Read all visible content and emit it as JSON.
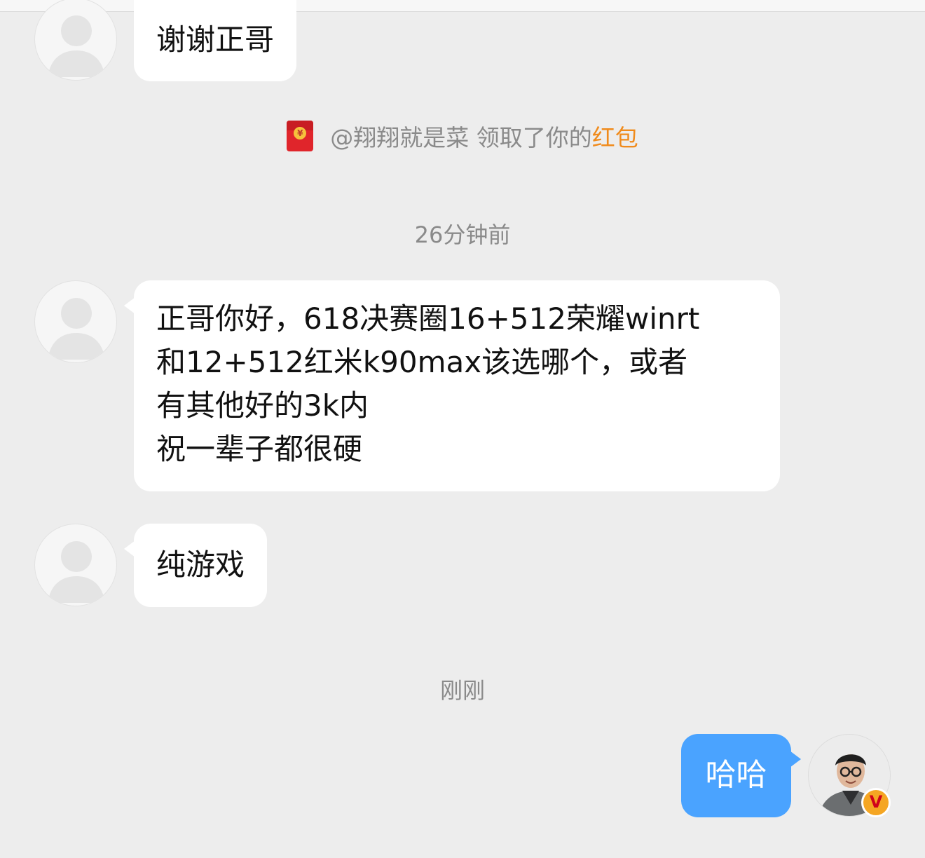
{
  "messages": [
    {
      "from": "other",
      "text_lines": [
        "谢谢正哥"
      ]
    },
    {
      "from": "other",
      "text_lines": [
        "正哥你好，618决赛圈16+512荣耀winrt",
        "和12+512红米k90max该选哪个，或者",
        "有其他好的3k内",
        "祝一辈子都很硬"
      ]
    },
    {
      "from": "other",
      "text_lines": [
        "纯游戏"
      ]
    },
    {
      "from": "me",
      "text_lines": [
        "哈哈"
      ]
    }
  ],
  "system": {
    "redpacket_prefix": "@翔翔就是菜 领取了你的",
    "redpacket_link": "红包",
    "time_1": "26分钟前",
    "time_2": "刚刚"
  },
  "badge": {
    "label": "V"
  },
  "colors": {
    "background": "#ededed",
    "my_bubble": "#4aa3ff",
    "other_bubble": "#ffffff",
    "highlight": "#f08b1c"
  }
}
